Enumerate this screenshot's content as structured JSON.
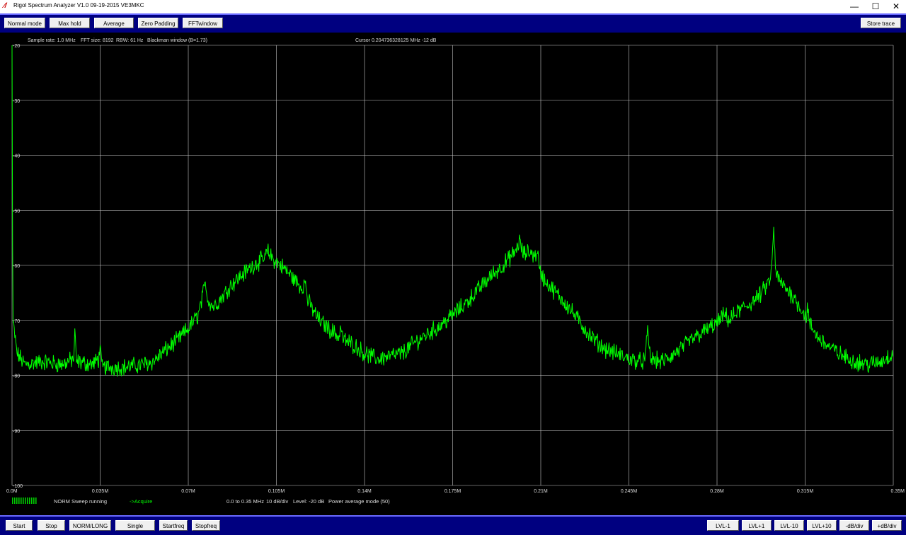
{
  "window": {
    "title": "Rigol Spectrum Analyzer V1.0 09-19-2015 VE3MKC",
    "app_icon": "rigol-icon",
    "controls": {
      "minimize": "—",
      "maximize": "☐",
      "close": "✕"
    }
  },
  "toolbar": {
    "normal_mode": "Normal mode",
    "max_hold": "Max hold",
    "average": "Average",
    "zero_padding": "Zero Padding",
    "fft_window": "FFTwindow",
    "store_trace": "Store trace"
  },
  "info": {
    "sample_rate": "Sample rate: 1.0 MHz",
    "fft_size": "FFT size: 8192",
    "rbw": "RBW: 61 Hz",
    "window": "Blackman window (B=1.73)",
    "cursor": "Cursor 0.204736328125 MHz   -12 dB"
  },
  "status": {
    "sweep": "NORM Sweep running",
    "acquire": "->Acquire",
    "range": "0.0 to 0.35 MHz",
    "scale": "10 dB/div",
    "level": "Level: -20 dB",
    "mode": "Power average  mode (50)"
  },
  "bottom": {
    "start": "Start",
    "stop": "Stop",
    "norm_long": "NORM/LONG",
    "single": "Single",
    "startfreq": "Startfreq",
    "stopfreq": "Stopfreq",
    "lvl_m1": "LVL-1",
    "lvl_p1": "LVL+1",
    "lvl_m10": "LVL-10",
    "lvl_p10": "LVL+10",
    "db_div_minus": "-dB/div",
    "db_div_plus": "+dB/div"
  },
  "colors": {
    "trace": "#00ff00",
    "grid": "#c8c8c8",
    "toolbar": "#000080",
    "background": "#000000"
  },
  "chart_data": {
    "type": "line",
    "xlim": [
      0,
      0.35
    ],
    "ylim": [
      -100,
      -20
    ],
    "x_ticks": [
      {
        "value": 0,
        "label": "0.0M"
      },
      {
        "value": 0.035,
        "label": "0.035M"
      },
      {
        "value": 0.07,
        "label": "0.07M"
      },
      {
        "value": 0.105,
        "label": "0.105M"
      },
      {
        "value": 0.14,
        "label": "0.14M"
      },
      {
        "value": 0.175,
        "label": "0.175M"
      },
      {
        "value": 0.21,
        "label": "0.21M"
      },
      {
        "value": 0.245,
        "label": "0.245M"
      },
      {
        "value": 0.28,
        "label": "0.28M"
      },
      {
        "value": 0.315,
        "label": "0.315M"
      },
      {
        "value": 0.35,
        "label": "0.35M"
      }
    ],
    "y_ticks": [
      {
        "value": -20,
        "label": "-20"
      },
      {
        "value": -30,
        "label": "-30"
      },
      {
        "value": -40,
        "label": "-40"
      },
      {
        "value": -50,
        "label": "-50"
      },
      {
        "value": -60,
        "label": "-60"
      },
      {
        "value": -70,
        "label": "-70"
      },
      {
        "value": -80,
        "label": "-80"
      },
      {
        "value": -90,
        "label": "-90"
      },
      {
        "value": -100,
        "label": "-100"
      }
    ],
    "grid": true,
    "series": [
      {
        "color": "#00ff00",
        "points": [
          [
            0.0,
            -20
          ],
          [
            0.0003,
            -70
          ],
          [
            0.002,
            -76
          ],
          [
            0.005,
            -78
          ],
          [
            0.012,
            -77.5
          ],
          [
            0.02,
            -78
          ],
          [
            0.0245,
            -77
          ],
          [
            0.025,
            -72
          ],
          [
            0.0255,
            -77.5
          ],
          [
            0.032,
            -78
          ],
          [
            0.0345,
            -77
          ],
          [
            0.035,
            -74
          ],
          [
            0.0355,
            -78.5
          ],
          [
            0.045,
            -78.5
          ],
          [
            0.052,
            -78
          ],
          [
            0.056,
            -77.5
          ],
          [
            0.062,
            -75
          ],
          [
            0.066,
            -73.5
          ],
          [
            0.07,
            -71.5
          ],
          [
            0.074,
            -69
          ],
          [
            0.076,
            -65
          ],
          [
            0.077,
            -63
          ],
          [
            0.0775,
            -66
          ],
          [
            0.08,
            -67.5
          ],
          [
            0.083,
            -66
          ],
          [
            0.087,
            -63.5
          ],
          [
            0.092,
            -61.5
          ],
          [
            0.097,
            -59.5
          ],
          [
            0.1,
            -59
          ],
          [
            0.1015,
            -57.5
          ],
          [
            0.104,
            -59
          ],
          [
            0.108,
            -60.5
          ],
          [
            0.112,
            -62.5
          ],
          [
            0.115,
            -64
          ],
          [
            0.1165,
            -63
          ],
          [
            0.1175,
            -66.5
          ],
          [
            0.122,
            -70
          ],
          [
            0.126,
            -71.5
          ],
          [
            0.13,
            -73
          ],
          [
            0.1305,
            -71
          ],
          [
            0.1315,
            -73.5
          ],
          [
            0.136,
            -74.5
          ],
          [
            0.14,
            -76
          ],
          [
            0.145,
            -77
          ],
          [
            0.15,
            -76.5
          ],
          [
            0.155,
            -76
          ],
          [
            0.16,
            -74
          ],
          [
            0.165,
            -72.5
          ],
          [
            0.17,
            -71
          ],
          [
            0.175,
            -69
          ],
          [
            0.18,
            -67
          ],
          [
            0.185,
            -64.5
          ],
          [
            0.19,
            -62
          ],
          [
            0.195,
            -60
          ],
          [
            0.198,
            -58.5
          ],
          [
            0.2,
            -57.5
          ],
          [
            0.2015,
            -55.5
          ],
          [
            0.203,
            -58
          ],
          [
            0.206,
            -57.5
          ],
          [
            0.208,
            -58.5
          ],
          [
            0.2085,
            -56.5
          ],
          [
            0.2095,
            -61
          ],
          [
            0.212,
            -63
          ],
          [
            0.216,
            -65
          ],
          [
            0.22,
            -67
          ],
          [
            0.225,
            -70
          ],
          [
            0.23,
            -73
          ],
          [
            0.235,
            -75
          ],
          [
            0.24,
            -76
          ],
          [
            0.245,
            -77
          ],
          [
            0.25,
            -77.5
          ],
          [
            0.2515,
            -77
          ],
          [
            0.2525,
            -71.5
          ],
          [
            0.2535,
            -77
          ],
          [
            0.258,
            -77.5
          ],
          [
            0.262,
            -76.5
          ],
          [
            0.266,
            -75
          ],
          [
            0.27,
            -73.5
          ],
          [
            0.275,
            -72
          ],
          [
            0.28,
            -70.5
          ],
          [
            0.283,
            -69
          ],
          [
            0.285,
            -70
          ],
          [
            0.288,
            -68.5
          ],
          [
            0.293,
            -67
          ],
          [
            0.297,
            -65.5
          ],
          [
            0.3,
            -63.5
          ],
          [
            0.3015,
            -62
          ],
          [
            0.3025,
            -53.5
          ],
          [
            0.3035,
            -62
          ],
          [
            0.306,
            -63.5
          ],
          [
            0.31,
            -65.5
          ],
          [
            0.313,
            -67.5
          ],
          [
            0.3155,
            -69.5
          ],
          [
            0.316,
            -67
          ],
          [
            0.3165,
            -70.5
          ],
          [
            0.32,
            -73
          ],
          [
            0.325,
            -75
          ],
          [
            0.33,
            -76.5
          ],
          [
            0.335,
            -77.5
          ],
          [
            0.34,
            -78
          ],
          [
            0.345,
            -77.5
          ],
          [
            0.35,
            -76
          ]
        ]
      }
    ]
  }
}
